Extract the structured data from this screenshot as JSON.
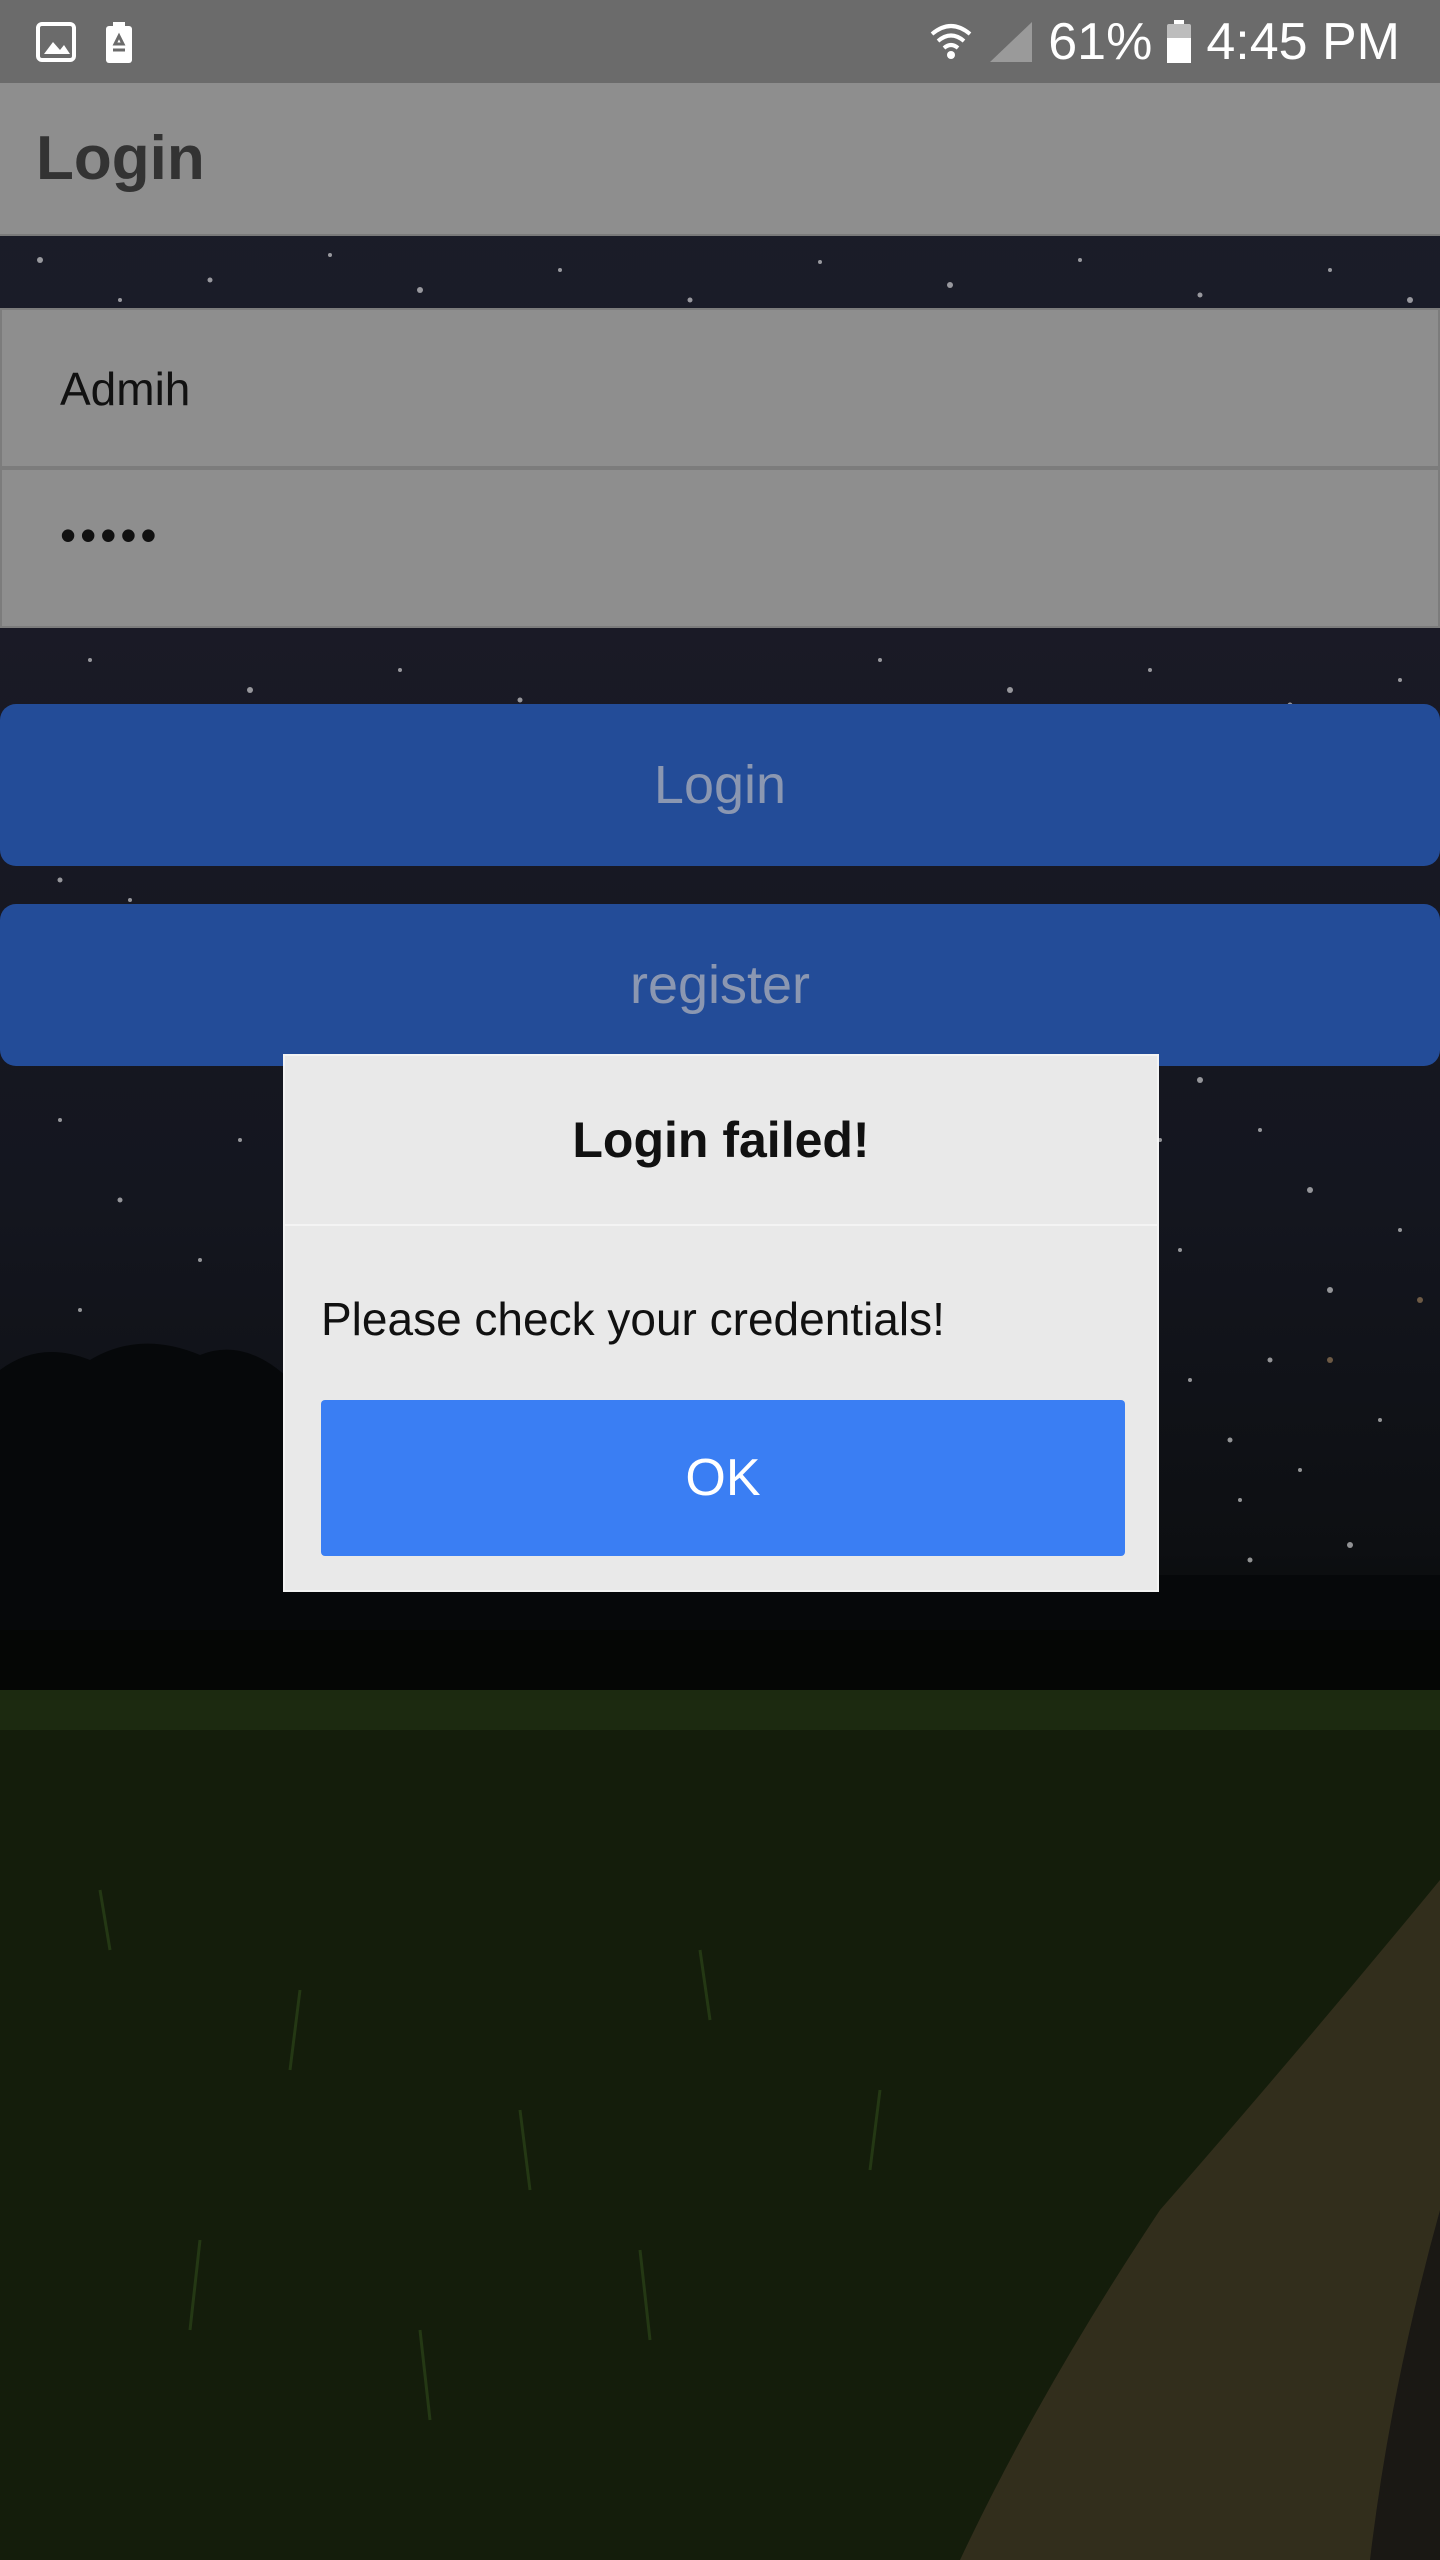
{
  "status_bar": {
    "battery_percent": "61%",
    "time": "4:45 PM",
    "left_icons": [
      "gallery-icon",
      "battery-saver-icon"
    ],
    "right_icons": [
      "wifi-icon",
      "cell-signal-icon",
      "battery-icon"
    ]
  },
  "app_bar": {
    "title": "Login"
  },
  "form": {
    "username_value": "Admih",
    "password_value": "•••••",
    "login_label": "Login",
    "register_label": "register"
  },
  "dialog": {
    "title": "Login failed!",
    "message": "Please check your credentials!",
    "ok_label": "OK"
  },
  "colors": {
    "button_primary": "#234c98",
    "dialog_ok": "#3a7ef3",
    "app_bar": "#8e8e8e"
  }
}
